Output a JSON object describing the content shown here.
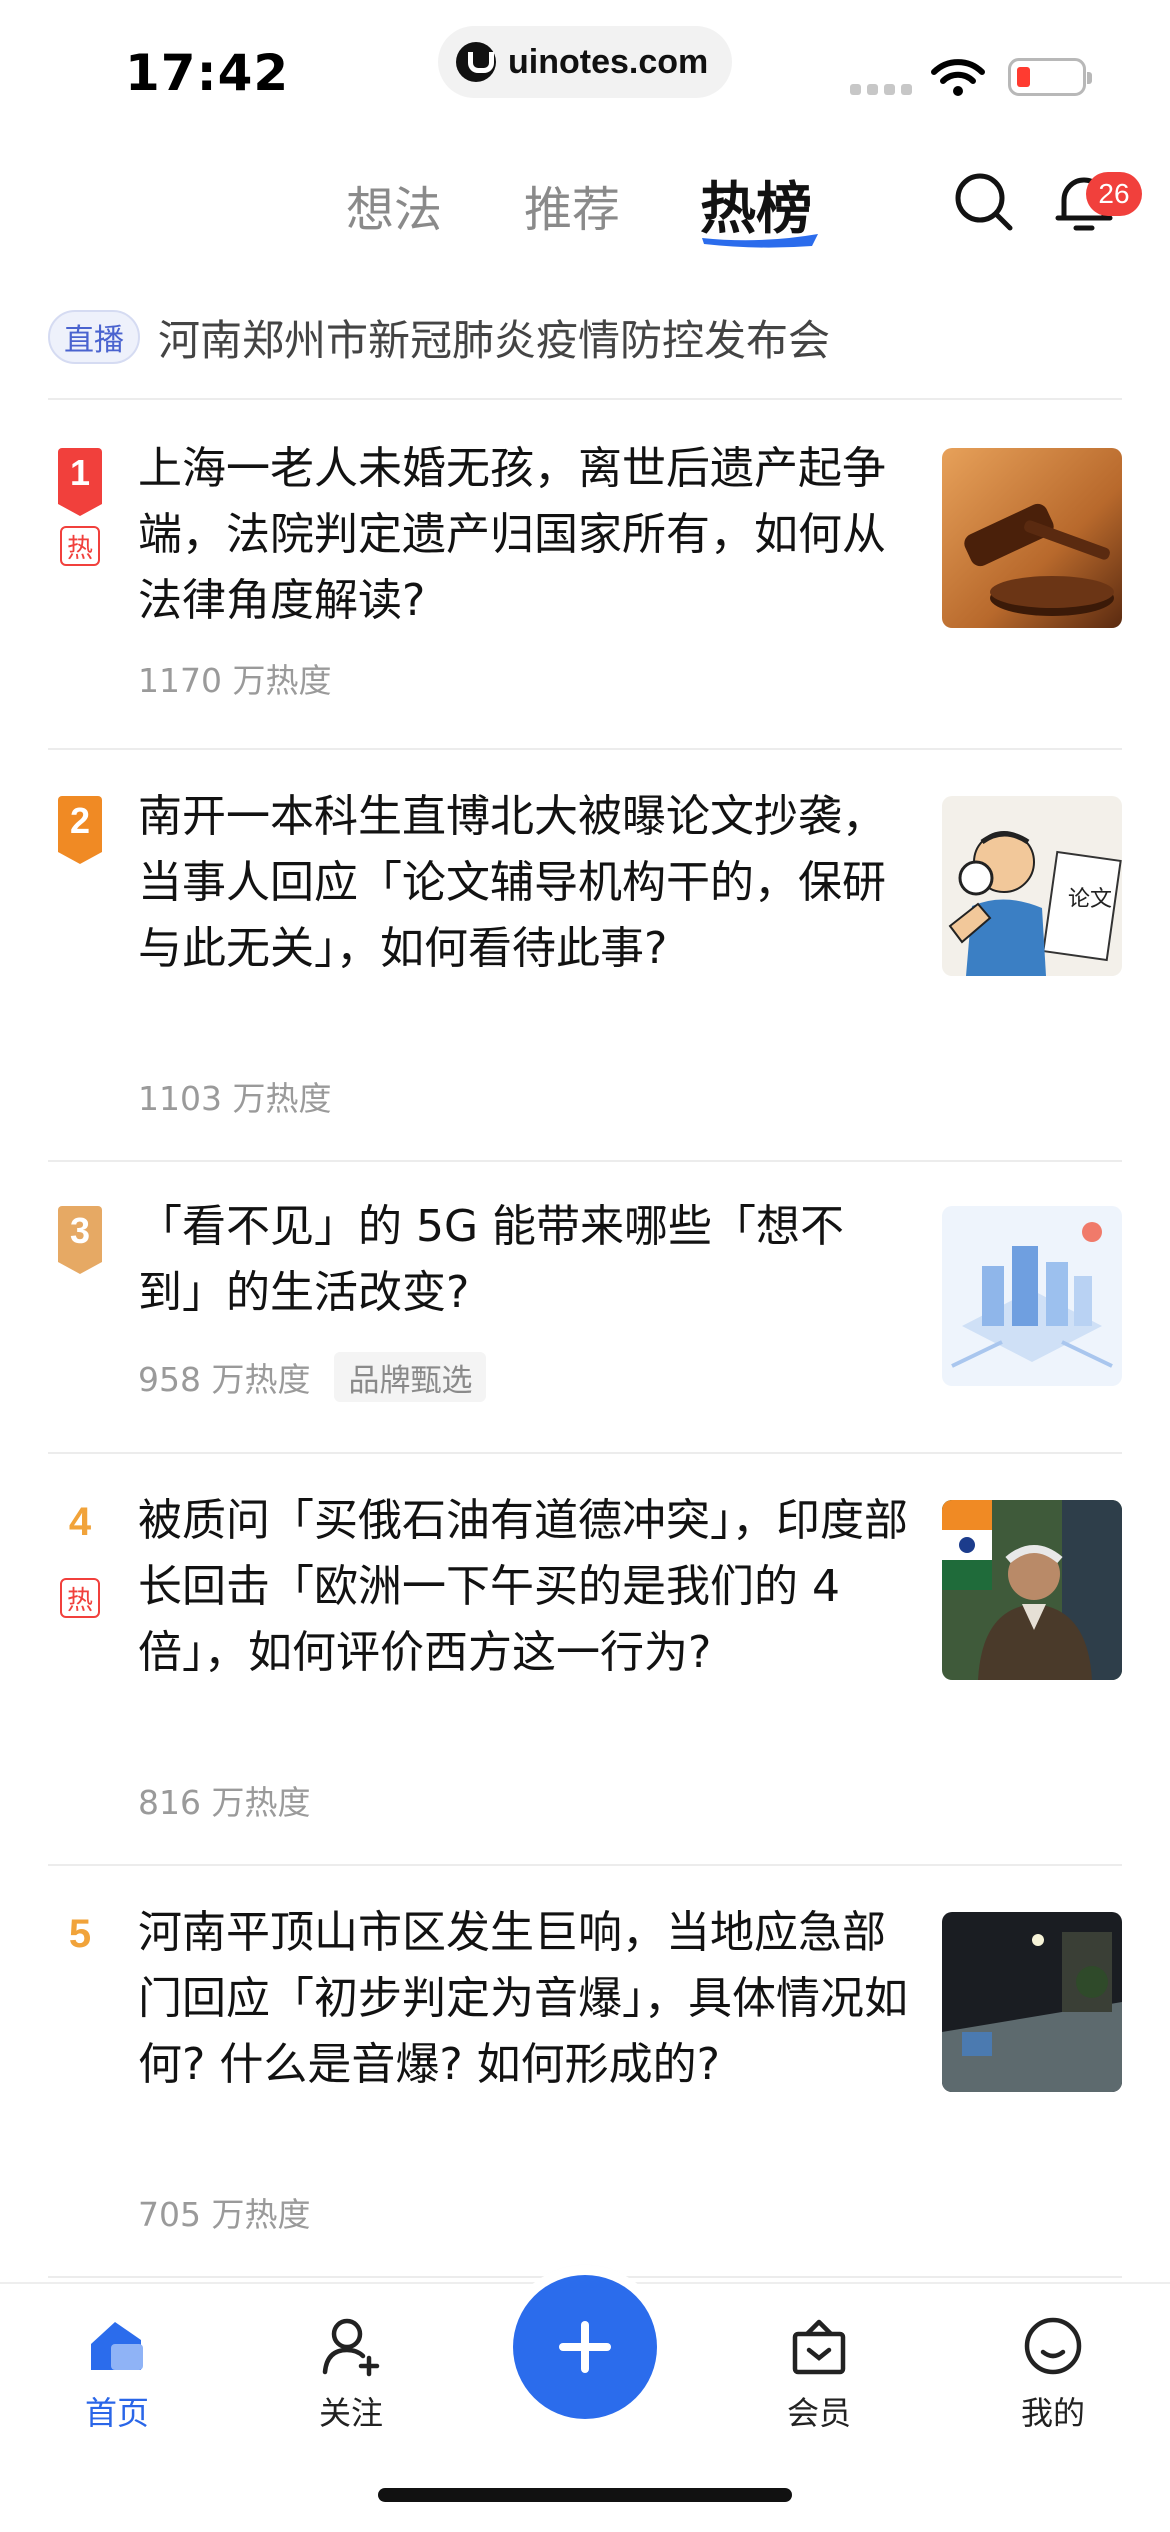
{
  "status_bar": {
    "time": "17:42",
    "url": "uinotes.com"
  },
  "top_nav": {
    "tabs": [
      "想法",
      "推荐",
      "热榜"
    ],
    "active_tab": "热榜",
    "notification_count": "26"
  },
  "live_banner": {
    "tag": "直播",
    "title": "河南郑州市新冠肺炎疫情防控发布会"
  },
  "hot_list": [
    {
      "rank": "1",
      "hot_badge": "热",
      "title": "上海一老人未婚无孩，离世后遗产起争端，法院判定遗产归国家所有，如何从法律角度解读?",
      "heat": "1170 万热度",
      "thumb": "gavel-image"
    },
    {
      "rank": "2",
      "title": "南开一本科生直博北大被曝论文抄袭，当事人回应「论文辅导机构干的，保研与此无关」，如何看待此事?",
      "heat": "1103 万热度",
      "thumb": "cartoon-plagiarism-image"
    },
    {
      "rank": "3",
      "title": "「看不见」的 5G 能带来哪些「想不到」的生活改变?",
      "heat": "958 万热度",
      "brand_tag": "品牌甄选",
      "thumb": "5g-city-illustration"
    },
    {
      "rank": "4",
      "hot_badge": "热",
      "title": "被质问「买俄石油有道德冲突」，印度部长回击「欧洲一下午买的是我们的 4 倍」，如何评价西方这一行为?",
      "heat": "816 万热度",
      "thumb": "minister-photo"
    },
    {
      "rank": "5",
      "title": "河南平顶山市区发生巨响，当地应急部门回应「初步判定为音爆」，具体情况如何? 什么是音爆? 如何形成的?",
      "heat": "705 万热度",
      "thumb": "night-street-photo"
    }
  ],
  "tab_bar": {
    "home": "首页",
    "follow": "关注",
    "vip": "会员",
    "me": "我的"
  },
  "colors": {
    "accent_blue": "#2b6cec",
    "rank1": "#f1403c",
    "rank2": "#f08a24",
    "rank3": "#e6a964",
    "rank_plain": "#f1a33a",
    "badge_red": "#f1403c"
  }
}
